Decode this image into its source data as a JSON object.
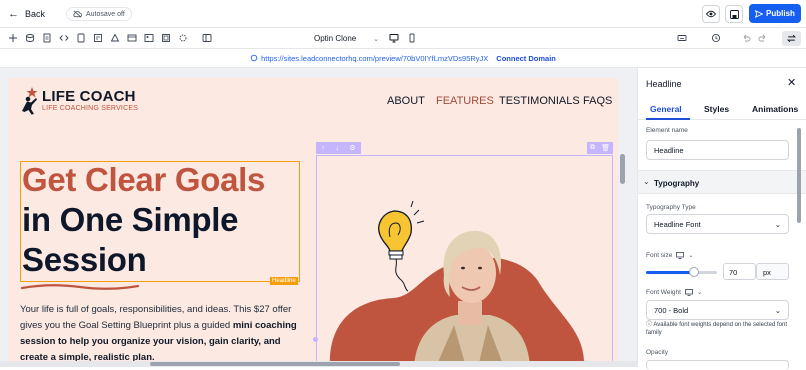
{
  "topbar": {
    "back_label": "Back",
    "autosave_label": "Autosave off",
    "publish_label": "Publish"
  },
  "toolbar": {
    "template_select": "Optin Clone"
  },
  "urlbar": {
    "url": "https://sites.leadconnectorhq.com/preview/70bV0IYfLmzVDs95RyJX",
    "connect_label": "Connect Domain"
  },
  "site": {
    "logo_title": "LIFE COACH",
    "logo_subtitle": "LIFE COACHING SERVICES",
    "nav": [
      "ABOUT",
      "FEATURES",
      "TESTIMONIALS",
      "FAQS"
    ],
    "active_nav": "FEATURES",
    "headline_line1": "Get Clear Goals",
    "headline_line2": "in One Simple",
    "headline_line3": "Session",
    "headline_badge": "Headline",
    "body_plain": "Your life is full of goals, responsibilities, and ideas. This $27 offer gives you the Goal Setting Blueprint plus a guided ",
    "body_bold": "mini coaching session to help you organize your vision, gain clarity, and create a simple, realistic plan."
  },
  "panel": {
    "title": "Headline",
    "tabs": [
      "General",
      "Styles",
      "Animations"
    ],
    "active_tab": "General",
    "element_name_label": "Element name",
    "element_name_value": "Headline",
    "section_typography": "Typography",
    "typography_type_label": "Typography Type",
    "typography_type_value": "Headline Font",
    "font_size_label": "Font size",
    "font_size_value": "70",
    "font_size_unit": "px",
    "font_size_slider_fraction": 0.68,
    "font_weight_label": "Font Weight",
    "font_weight_value": "700 - Bold",
    "font_weight_note": "Available font weights depend on the selected font family",
    "opacity_label": "Opacity"
  },
  "colors": {
    "accent_blue": "#155eef",
    "brand_rust": "#c0553f",
    "page_bg": "#fbe9e2",
    "selection_orange": "#f59e0b",
    "selection_purple": "#c4b5fd"
  }
}
